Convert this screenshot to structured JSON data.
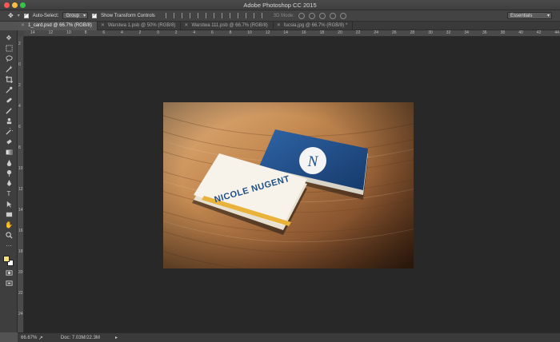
{
  "window": {
    "title": "Adobe Photoshop CC 2015",
    "colors": {
      "close": "#fc5753",
      "minimize": "#fdbc40",
      "zoom": "#33c748"
    }
  },
  "options_bar": {
    "move_tool_icon": "move-icon",
    "auto_select_label": "Auto-Select:",
    "auto_select_checked": true,
    "auto_select_target": "Group",
    "transform_controls_label": "Show Transform Controls",
    "transform_controls_checked": true,
    "mode_3d_label": "3D Mode:",
    "workspace": "Essentials"
  },
  "tabs": [
    {
      "label": "1_card.psd @ 66.7% (RGB/8)",
      "active": true
    },
    {
      "label": "Warstwa 1.psb @ 50% (RGB/8)",
      "active": false
    },
    {
      "label": "Warstwa 111.psb @ 66.7% (RGB/8)",
      "active": false
    },
    {
      "label": "fucsia.jpg @ 66.7% (RGB/8) *",
      "active": false
    }
  ],
  "ruler": {
    "h_ticks": [
      "14",
      "12",
      "10",
      "8",
      "6",
      "4",
      "2",
      "0",
      "2",
      "4",
      "6",
      "8",
      "10",
      "12",
      "14",
      "16",
      "18",
      "20",
      "22",
      "24",
      "26",
      "28",
      "30",
      "32",
      "34",
      "36",
      "38",
      "40",
      "42",
      "44"
    ],
    "v_ticks": [
      "2",
      "0",
      "2",
      "4",
      "6",
      "8",
      "10",
      "12",
      "14",
      "16",
      "18",
      "20",
      "22",
      "24"
    ]
  },
  "document": {
    "card_name": "NICOLE NUGENT",
    "card_monogram": "N",
    "colors": {
      "card_blue": "#1f4f86",
      "card_yellow": "#e9b23a",
      "wood": "#b87a44"
    }
  },
  "tools": [
    "move-icon",
    "marquee-icon",
    "lasso-icon",
    "magic-wand-icon",
    "crop-icon",
    "eyedropper-icon",
    "healing-brush-icon",
    "brush-icon",
    "clone-stamp-icon",
    "history-brush-icon",
    "eraser-icon",
    "gradient-icon",
    "blur-icon",
    "dodge-icon",
    "pen-icon",
    "type-icon",
    "path-selection-icon",
    "rectangle-icon",
    "hand-icon",
    "zoom-icon",
    "more-tools-icon"
  ],
  "swatches": {
    "foreground": "#f6e27a",
    "background": "#ffffff"
  },
  "status": {
    "zoom": "66.67%",
    "doc": "Doc: 7.03M/22.3M"
  }
}
